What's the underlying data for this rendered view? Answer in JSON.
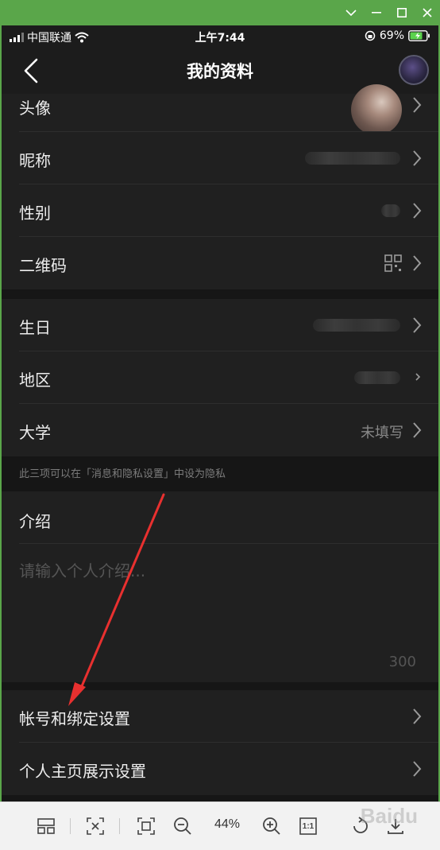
{
  "statusbar": {
    "carrier": "中国联通",
    "time": "上午7:44",
    "battery": "69%"
  },
  "navbar": {
    "title": "我的资料"
  },
  "rows": {
    "avatar": {
      "label": "头像"
    },
    "nickname": {
      "label": "昵称"
    },
    "gender": {
      "label": "性别"
    },
    "qrcode": {
      "label": "二维码"
    },
    "birthday": {
      "label": "生日"
    },
    "region": {
      "label": "地区"
    },
    "university": {
      "label": "大学",
      "value": "未填写"
    },
    "privacy_hint": "此三项可以在「消息和隐私设置」中设为隐私",
    "intro": {
      "label": "介绍",
      "placeholder": "请输入个人介绍...",
      "count": "300"
    },
    "account": {
      "label": "帐号和绑定设置"
    },
    "homepage": {
      "label": "个人主页展示设置"
    }
  },
  "toolbar": {
    "zoom": "44%",
    "actual_size": "1:1",
    "watermark": "Baidu"
  },
  "colors": {
    "window_green": "#5aa64a",
    "annotation_red": "#e8302f"
  },
  "icons": [
    "back-icon",
    "chevron-right-icon",
    "qrcode-icon",
    "wifi-icon",
    "battery-icon",
    "minimize-icon",
    "maximize-icon",
    "close-icon",
    "zoom-in-icon",
    "zoom-out-icon"
  ]
}
